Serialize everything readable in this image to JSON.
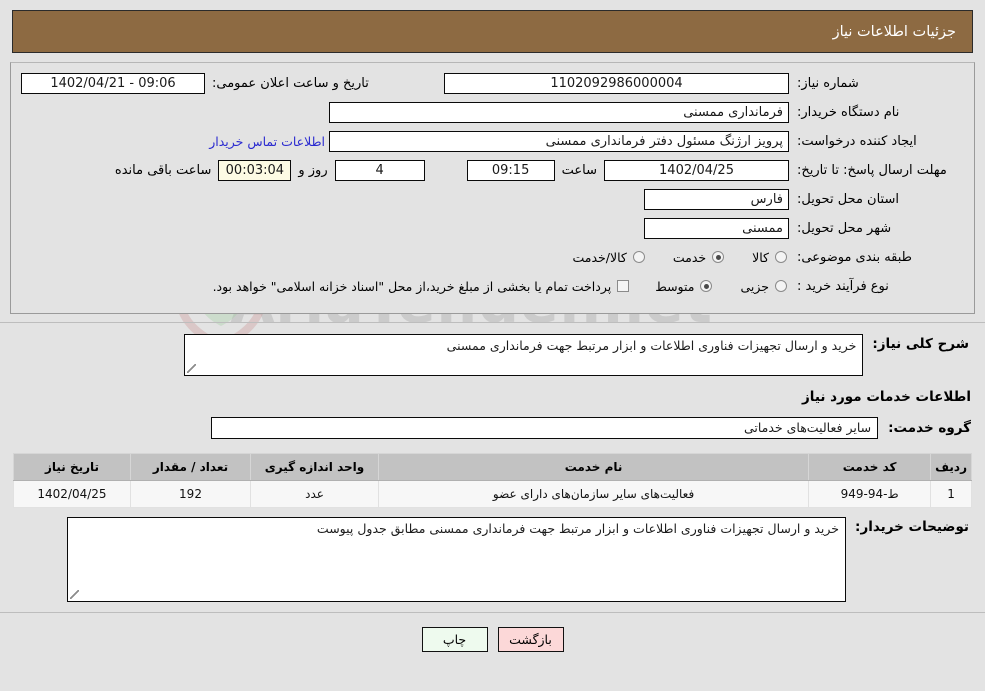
{
  "header": {
    "title": "جزئیات اطلاعات نیاز"
  },
  "watermark": {
    "text": "AriaTender.net"
  },
  "info": {
    "need_number_label": "شماره نیاز:",
    "need_number_value": "1102092986000004",
    "publish_label": "تاریخ و ساعت اعلان عمومی:",
    "publish_value": "09:06 - 1402/04/21",
    "buyer_org_label": "نام دستگاه خریدار:",
    "buyer_org_value": "فرمانداری ممسنی",
    "creator_label": "ایجاد کننده درخواست:",
    "creator_value": "پرویز ارژنگ مسئول دفتر فرمانداری ممسنی",
    "contact_link": "اطلاعات تماس خریدار",
    "deadline_label": "مهلت ارسال پاسخ: تا تاریخ:",
    "deadline_date": "1402/04/25",
    "hour_label": "ساعت",
    "deadline_time": "09:15",
    "days_remaining": "4",
    "days_and_label": "روز و",
    "countdown": "00:03:04",
    "remaining_label": "ساعت باقی مانده",
    "province_label": "استان محل تحویل:",
    "province_value": "فارس",
    "city_label": "شهر محل تحویل:",
    "city_value": "ممسنی",
    "category_label": "طبقه بندی موضوعی:",
    "category_options": [
      {
        "label": "کالا",
        "selected": false
      },
      {
        "label": "خدمت",
        "selected": true
      },
      {
        "label": "کالا/خدمت",
        "selected": false
      }
    ],
    "process_label": "نوع فرآیند خرید :",
    "process_options": [
      {
        "label": "جزیی",
        "selected": false
      },
      {
        "label": "متوسط",
        "selected": true
      }
    ],
    "treasury_checkbox_checked": false,
    "treasury_note": "پرداخت تمام یا بخشی از مبلغ خرید،از محل \"اسناد خزانه اسلامی\" خواهد بود."
  },
  "need_desc": {
    "label": "شرح کلی نیاز:",
    "value": "خرید و ارسال تجهیزات فناوری اطلاعات و ابزار مرتبط جهت فرمانداری ممسنی"
  },
  "services": {
    "section_title": "اطلاعات خدمات مورد نیاز",
    "group_label": "گروه خدمت:",
    "group_value": "سایر فعالیت‌های خدماتی",
    "columns": [
      "ردیف",
      "کد خدمت",
      "نام خدمت",
      "واحد اندازه گیری",
      "تعداد / مقدار",
      "تاریخ نیاز"
    ],
    "rows": [
      {
        "radif": "1",
        "code": "ط-94-949",
        "name": "فعالیت‌های سایر سازمان‌های دارای عضو",
        "unit": "عدد",
        "qty": "192",
        "date": "1402/04/25"
      }
    ]
  },
  "buyer_notes": {
    "label": "توضیحات خریدار:",
    "value": "خرید و ارسال تجهیزات فناوری اطلاعات و ابزار مرتبط جهت فرمانداری ممسنی مطابق جدول پیوست"
  },
  "footer": {
    "print_label": "چاپ",
    "back_label": "بازگشت"
  },
  "colors": {
    "header_bg": "#8d6a42",
    "page_bg": "#e3e3e3",
    "link": "#2a2ad0",
    "print_btn": "#eefaee",
    "back_btn": "#fcd8d8",
    "countdown_bg": "#fdfbe4"
  }
}
